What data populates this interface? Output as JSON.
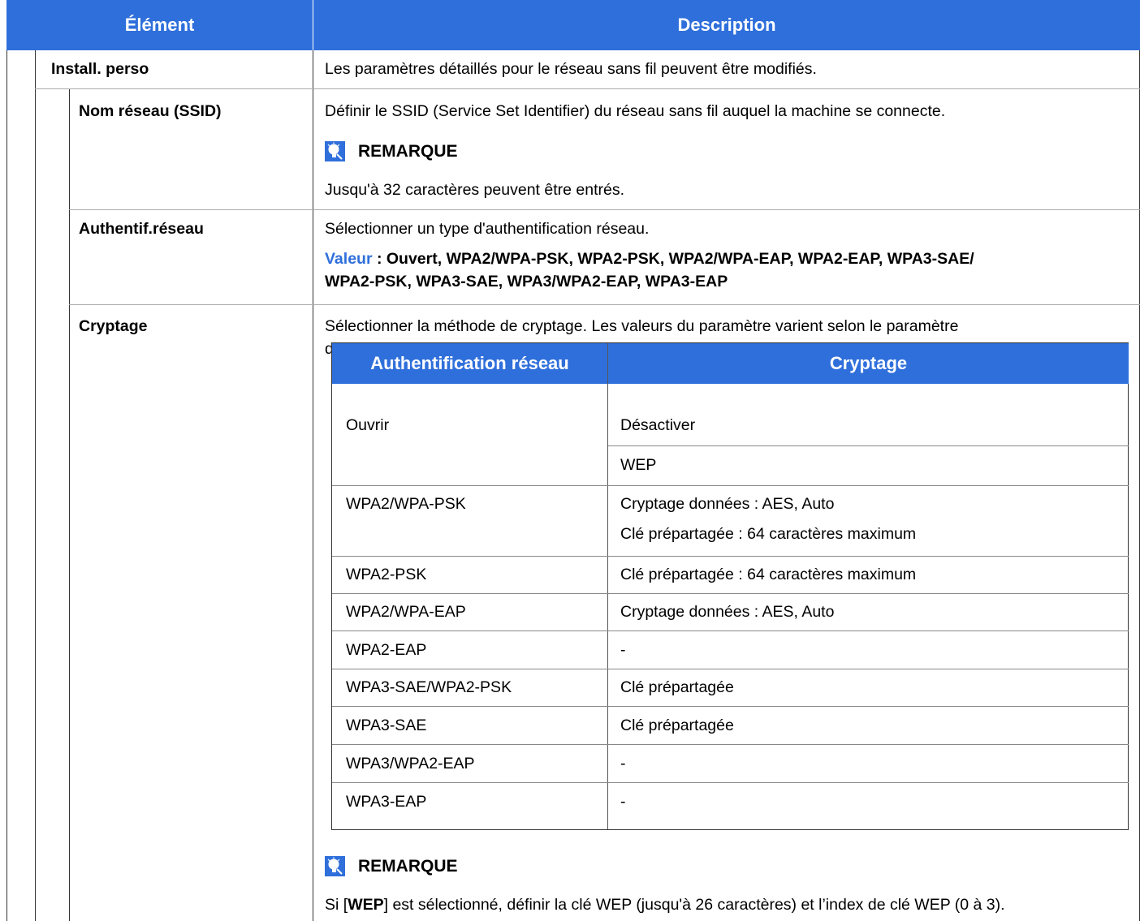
{
  "header": {
    "col_element": "Élément",
    "col_description": "Description"
  },
  "rows": {
    "install": {
      "label": "Install. perso",
      "desc": "Les paramètres détaillés pour le réseau sans fil peuvent être modifiés."
    },
    "ssid": {
      "label": "Nom réseau (SSID)",
      "desc": "Définir le SSID (Service Set Identifier) du réseau sans fil auquel la machine se connecte.",
      "note_title": "REMARQUE",
      "note_text": "Jusqu'à 32 caractères peuvent être entrés."
    },
    "auth": {
      "label": "Authentif.réseau",
      "desc": "Sélectionner un type d'authentification réseau.",
      "value_label": "Valeur",
      "value_line1": " : Ouvert, WPA2/WPA-PSK, WPA2-PSK, WPA2/WPA-EAP, WPA2-EAP, WPA3-SAE/",
      "value_line2": "WPA2-PSK, WPA3-SAE, WPA3/WPA2-EAP, WPA3-EAP"
    },
    "crypt": {
      "label": "Cryptage",
      "desc_line1": "Sélectionner la méthode de cryptage. Les valeurs du paramètre varient selon le paramètre",
      "desc_line2": "d'authentification réseau.",
      "note_title": "REMARQUE",
      "note_pre": "Si [",
      "note_bold": "WEP",
      "note_post": "] est sélectionné, définir la clé WEP (jusqu'à 26 caractères) et l’index de clé WEP (0 à 3)."
    }
  },
  "inner_table": {
    "headers": [
      "Authentification réseau",
      "Cryptage"
    ],
    "rows": [
      {
        "auth": "Ouvrir",
        "crypt": [
          "Désactiver",
          "WEP"
        ]
      },
      {
        "auth": "WPA2/WPA-PSK",
        "crypt": [
          "Cryptage données : AES, Auto",
          "Clé prépartagée : 64 caractères maximum"
        ]
      },
      {
        "auth": "WPA2-PSK",
        "crypt": [
          "Clé prépartagée : 64 caractères maximum"
        ]
      },
      {
        "auth": "WPA2/WPA-EAP",
        "crypt": [
          "Cryptage données : AES, Auto"
        ]
      },
      {
        "auth": "WPA2-EAP",
        "crypt": [
          "-"
        ]
      },
      {
        "auth": "WPA3-SAE/WPA2-PSK",
        "crypt": [
          "Clé prépartagée"
        ]
      },
      {
        "auth": "WPA3-SAE",
        "crypt": [
          "Clé prépartagée"
        ]
      },
      {
        "auth": "WPA3/WPA2-EAP",
        "crypt": [
          "-"
        ]
      },
      {
        "auth": "WPA3-EAP",
        "crypt": [
          "-"
        ]
      }
    ]
  },
  "colors": {
    "accent": "#2f6fdb",
    "icon": "#2f6fdb"
  },
  "icons": {
    "note": "lightbulb-icon"
  }
}
